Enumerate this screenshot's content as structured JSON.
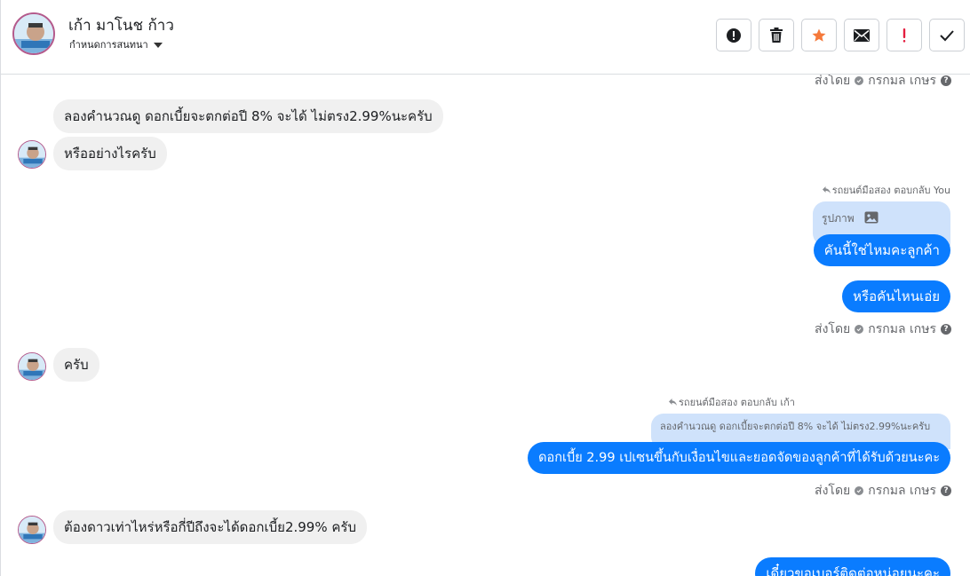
{
  "header": {
    "contact_name": "เก้า มาโนช ก้าว",
    "subtitle": "กำหนดการสนทนา"
  },
  "toolbar": {
    "buttons": [
      {
        "icon": "alert-circle-icon"
      },
      {
        "icon": "trash-icon"
      },
      {
        "icon": "star-icon",
        "color": "#f5793b"
      },
      {
        "icon": "envelope-icon"
      },
      {
        "icon": "exclamation-icon",
        "color": "#e41e3f"
      },
      {
        "icon": "checkmark-icon"
      }
    ]
  },
  "colors": {
    "outgoing_bubble": "#0a7cff",
    "incoming_bubble": "#f0f0f0",
    "reply_preview": "#cfe2fb"
  },
  "messages": {
    "sent_by_top": {
      "prefix": "ส่งโดย",
      "name": "กรกมล เกษร"
    },
    "in_1": "ลองคำนวณดู ดอกเบี้ยจะตกต่อปี 8% จะได้  ไม่ตรง2.99%นะครับ",
    "in_2": "หรืออย่างไรครับ",
    "reply_1_meta": "รถยนต์มือสอง ตอบกลับ You",
    "reply_1_preview": "รูปภาพ",
    "out_1": "คันนี้ใช่ไหมคะลูกค้า",
    "out_2": "หรือคันไหนเอ่ย",
    "sent_by_2": {
      "prefix": "ส่งโดย",
      "name": "กรกมล เกษร"
    },
    "in_3": "ครับ",
    "reply_2_meta": "รถยนต์มือสอง ตอบกลับ เก้า",
    "reply_2_preview": "ลองคำนวณดู ดอกเบี้ยจะตกต่อปี 8% จะได้ ไม่ตรง2.99%นะครับ",
    "out_3": "ดอกเบี้ย 2.99 เปเซนขึ้นกับเงื่อนไขและยอดจัดของลูกค้าที่ได้รับด้วยนะคะ",
    "sent_by_3": {
      "prefix": "ส่งโดย",
      "name": "กรกมล เกษร"
    },
    "in_4": "ต้องดาวเท่าไหร่หรือกี่ปีถึงจะได้ดอกเบี้ย2.99% ครับ",
    "out_4": "เดี๋ยวขอเบอร์ติดต่อหน่อยนะคะ"
  }
}
